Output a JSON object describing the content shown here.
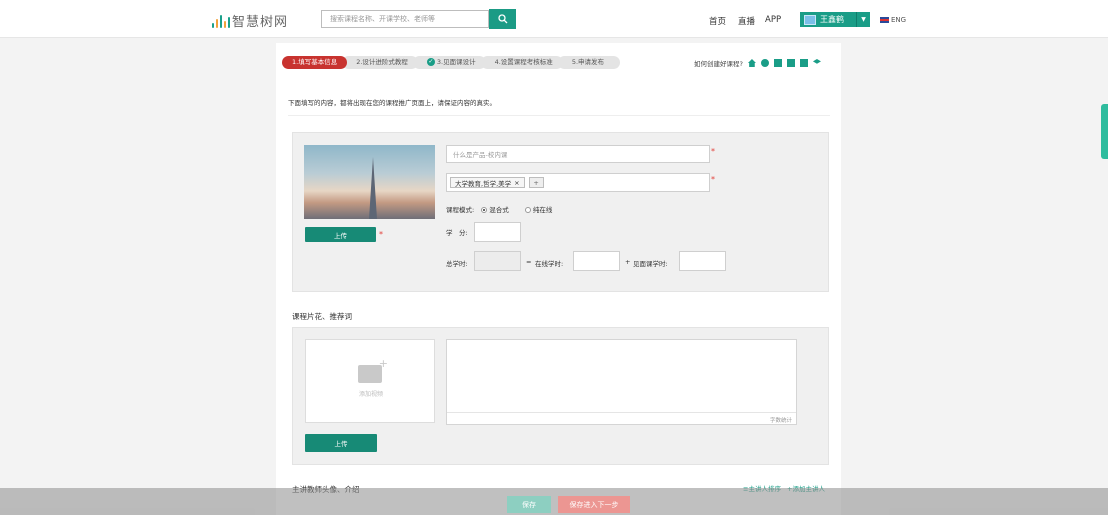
{
  "header": {
    "logo_text": "智慧树网",
    "search_placeholder": "搜索课程名称、开课学校、老师等",
    "nav": [
      "首页",
      "直播",
      "APP"
    ],
    "user_name": "王鑫鹤",
    "lang_label": "ENG"
  },
  "steps": [
    {
      "label": "1.填写基本信息",
      "state": "active"
    },
    {
      "label": "2.设计进阶式教程",
      "state": "todo"
    },
    {
      "label": "3.见面课设计",
      "state": "done"
    },
    {
      "label": "4.设置课程考核标准",
      "state": "todo"
    },
    {
      "label": "5.申请发布",
      "state": "todo"
    }
  ],
  "howto_label": "如何创建好课程?",
  "notice": "下面填写的内容，都将出现在您的课程推广页面上，请保证内容的真实。",
  "basic": {
    "upload_label": "上传",
    "name_placeholder": "什么是产品-校内课",
    "tag": "大学教育,哲学,美学",
    "tag_remove": "×",
    "tag_add": "+",
    "mode_label": "课程模式:",
    "mode_options": [
      "混合式",
      "纯在线"
    ],
    "mode_selected": "混合式",
    "credit_label": "学　分:",
    "total_hours_label": "总学时:",
    "equals": "=",
    "online_hours_label": "在线学时:",
    "plus": "+",
    "meet_hours_label": "见面课学时:"
  },
  "video_section": {
    "title": "课程片花、推荐词",
    "video_label": "添加视频",
    "upload_label": "上传",
    "counter_label": "字数统计"
  },
  "teacher_section": {
    "title": "主讲教师头像、介绍",
    "sort_link": "≡主讲人排序",
    "add_link": "+添加主讲人"
  },
  "footer": {
    "save_label": "保存",
    "save_next_label": "保存进入下一步"
  },
  "colors": {
    "brand_green": "#1a9d87",
    "active_step": "#c8332f",
    "required": "#e2403a"
  }
}
